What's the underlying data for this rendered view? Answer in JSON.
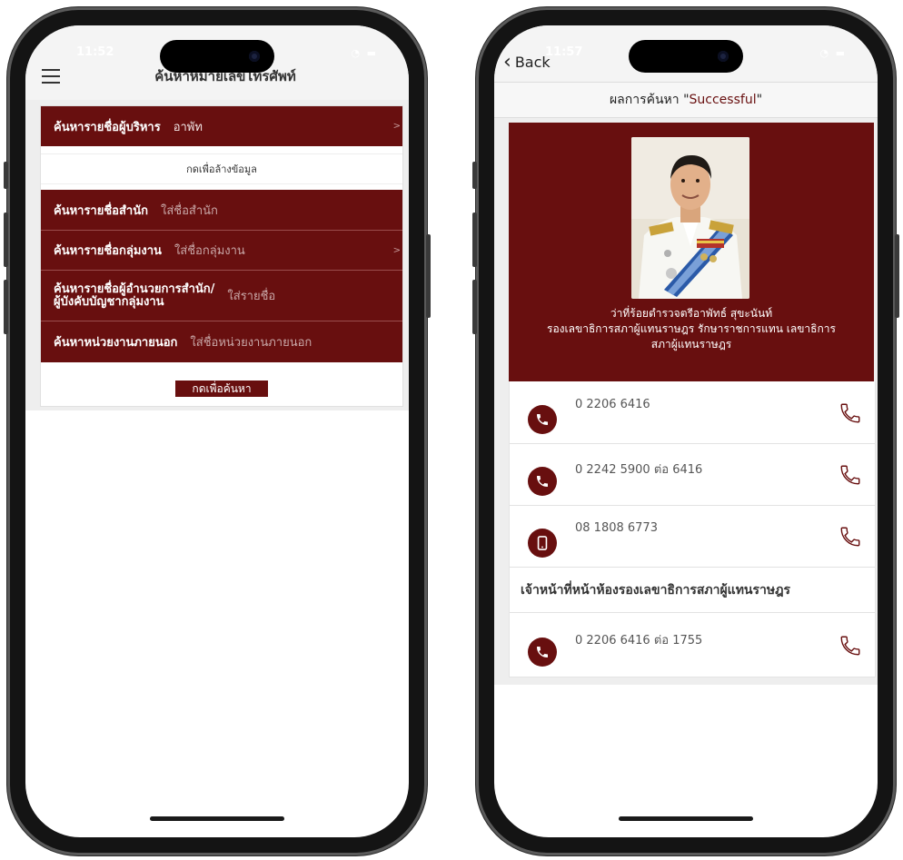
{
  "left_screen": {
    "status_time": "11:52",
    "header_title": "ค้นหาหมายเลขโทรศัพท์",
    "rows": [
      {
        "label": "ค้นหารายชื่อผู้บริหาร",
        "value": "อาพัท"
      }
    ],
    "clear_button": "กดเพื่อล้างข้อมูล",
    "search_rows": [
      {
        "label": "ค้นหารายชื่อสำนัก",
        "placeholder": "ใส่ชื่อสำนัก"
      },
      {
        "label": "ค้นหารายชื่อกลุ่มงาน",
        "placeholder": "ใส่ชื่อกลุ่มงาน"
      },
      {
        "label_line1": "ค้นหารายชื่อผู้อำนวยการสำนัก/",
        "label_line2": "ผู้บังคับบัญชากลุ่มงาน",
        "placeholder": "ใส่รายชื่อ"
      },
      {
        "label": "ค้นหาหน่วยงานภายนอก",
        "placeholder": "ใส่ชื่อหน่วยงานภายนอก"
      }
    ],
    "search_button": "กดเพื่อค้นหา",
    "chevron": ">"
  },
  "right_screen": {
    "status_time": "11:57",
    "back_label": "Back",
    "result_prefix": "ผลการค้นหา \" ",
    "result_query": "Successful",
    "result_suffix": " \"",
    "person_name": "ว่าที่ร้อยตำรวจตรีอาพัทธ์ สุขะนันท์",
    "person_position_1": "รองเลขาธิการสภาผู้แทนราษฎร รักษาราชการแทน เลขาธิการ",
    "person_position_2": "สภาผู้แทนราษฎร",
    "contacts": [
      {
        "number": "0 2206 6416",
        "icon": "phone-icon"
      },
      {
        "number": "0 2242 5900  ต่อ 6416",
        "icon": "phone-icon"
      },
      {
        "number": "08 1808 6773",
        "icon": "mobile-icon"
      }
    ],
    "section_title": "เจ้าหน้าที่หน้าห้องรองเลขาธิการสภาผู้แทนราษฎร",
    "section_contacts": [
      {
        "number": "0 2206 6416  ต่อ 1755",
        "icon": "phone-icon"
      }
    ]
  },
  "colors": {
    "maroon": "#680f0f",
    "background": "#eeeeee"
  }
}
